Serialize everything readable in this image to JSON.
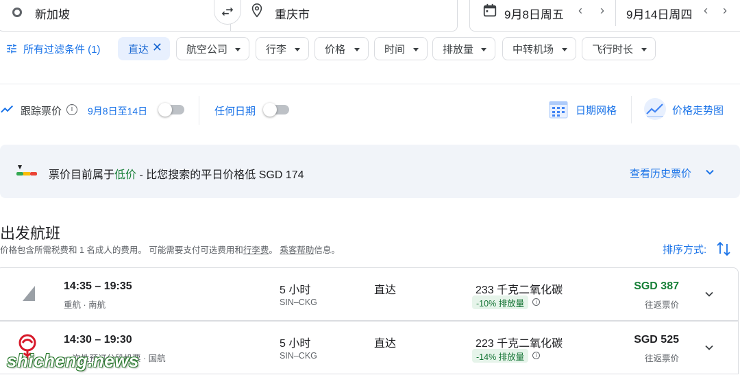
{
  "search": {
    "origin": "新加坡",
    "destination": "重庆市",
    "depart_date": "9月8日周五",
    "return_date": "9月14日周四"
  },
  "filters": {
    "all_filters_label": "所有过滤条件 (1)",
    "chips": [
      "直达",
      "航空公司",
      "行李",
      "价格",
      "时间",
      "排放量",
      "中转机场",
      "飞行时长"
    ]
  },
  "tracking": {
    "track_label": "跟踪票价",
    "date_range": "9月8日至14日",
    "any_dates_label": "任何日期",
    "date_grid_label": "日期网格",
    "price_graph_label": "价格走势图"
  },
  "insight": {
    "text_prefix": "票价目前属于",
    "level": "低价",
    "text_suffix": " - 比您搜索的平日价格低 SGD 174",
    "history_label": "查看历史票价"
  },
  "results": {
    "title": "出发航班",
    "subtitle_prefix": "价格包含所需税费和 1 名成人的费用。 可能需要支付可选费用和",
    "baggage_fee_link": "行李费",
    "subtitle_mid": "。 ",
    "help_link": "乘客帮助",
    "subtitle_suffix": "信息。",
    "sort_label": "排序方式:"
  },
  "flights": [
    {
      "time": "14:35 – 19:35",
      "airline": "重航 · 南航",
      "duration": "5 小时",
      "route": "SIN–CKG",
      "stops": "直达",
      "co2": "233 千克二氧化碳",
      "emission_badge": "-10% 排放量",
      "price": "SGD 387",
      "price_color": "#188038",
      "price_type": "往返票价"
    },
    {
      "time": "14:30 – 19:30",
      "airline": "一次性预订分段机票 · 国航",
      "duration": "5 小时",
      "route": "SIN–CKG",
      "stops": "直达",
      "co2": "223 千克二氧化碳",
      "emission_badge": "-14% 排放量",
      "price": "SGD 525",
      "price_color": "#202124",
      "price_type": "往返票价"
    }
  ],
  "watermark": "shicheng.news",
  "colors": {
    "accent": "#1a73e8",
    "low_price": "#188038",
    "insight_bg": "#f1f4f9"
  }
}
